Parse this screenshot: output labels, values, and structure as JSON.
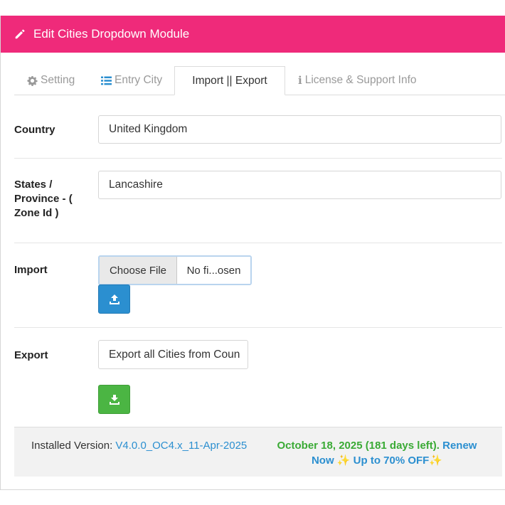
{
  "header": {
    "title": "Edit Cities Dropdown Module",
    "color": "#ef2a7a"
  },
  "tabs": [
    {
      "label": "Setting",
      "icon": "gear-icon",
      "active": false
    },
    {
      "label": "Entry City",
      "icon": "list-icon",
      "active": false
    },
    {
      "label": "Import || Export",
      "icon": "",
      "active": true
    },
    {
      "label": "License & Support Info",
      "icon": "info-icon",
      "active": false
    }
  ],
  "form": {
    "country": {
      "label": "Country",
      "value": "United Kingdom"
    },
    "state": {
      "label_line1": "States /",
      "label_line2": "Province - (",
      "label_line3": "Zone Id )",
      "value": "Lancashire"
    },
    "import": {
      "label": "Import",
      "choose_file": "Choose File",
      "file_name": "No fi...osen",
      "upload_icon": "upload-icon"
    },
    "export": {
      "label": "Export",
      "button": "Export all Cities from Coun",
      "download_icon": "download-icon"
    }
  },
  "footer": {
    "installed_label": "Installed Version:",
    "version": "V4.0.0_OC4.x_11-Apr-2025",
    "expiry": "October 18, 2025 (181 days left).",
    "renew": "Renew",
    "now": "Now",
    "offer": "Up to 70% OFF",
    "sparkle": "✨"
  }
}
